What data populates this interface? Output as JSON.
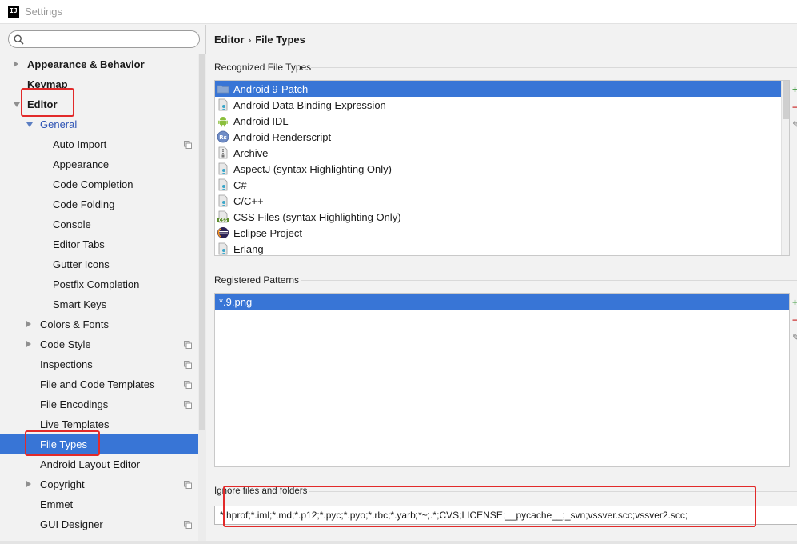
{
  "window": {
    "title": "Settings",
    "app_icon_text": "IJ"
  },
  "search": {
    "placeholder": ""
  },
  "sidebar": {
    "items": [
      {
        "label": "Appearance & Behavior",
        "level": 0,
        "arrow": "right",
        "bold": true
      },
      {
        "label": "Keymap",
        "level": 0,
        "arrow": "none",
        "bold": true
      },
      {
        "label": "Editor",
        "level": 0,
        "arrow": "down",
        "bold": true
      },
      {
        "label": "General",
        "level": 1,
        "arrow": "down",
        "color": "blue"
      },
      {
        "label": "Auto Import",
        "level": 2,
        "copy_icon": true
      },
      {
        "label": "Appearance",
        "level": 2
      },
      {
        "label": "Code Completion",
        "level": 2
      },
      {
        "label": "Code Folding",
        "level": 2
      },
      {
        "label": "Console",
        "level": 2
      },
      {
        "label": "Editor Tabs",
        "level": 2
      },
      {
        "label": "Gutter Icons",
        "level": 2
      },
      {
        "label": "Postfix Completion",
        "level": 2
      },
      {
        "label": "Smart Keys",
        "level": 2
      },
      {
        "label": "Colors & Fonts",
        "level": 1,
        "arrow": "right"
      },
      {
        "label": "Code Style",
        "level": 1,
        "arrow": "right",
        "copy_icon": true
      },
      {
        "label": "Inspections",
        "level": 1,
        "copy_icon": true
      },
      {
        "label": "File and Code Templates",
        "level": 1,
        "copy_icon": true
      },
      {
        "label": "File Encodings",
        "level": 1,
        "copy_icon": true
      },
      {
        "label": "Live Templates",
        "level": 1
      },
      {
        "label": "File Types",
        "level": 1,
        "selected": true
      },
      {
        "label": "Android Layout Editor",
        "level": 1
      },
      {
        "label": "Copyright",
        "level": 1,
        "arrow": "right",
        "copy_icon": true
      },
      {
        "label": "Emmet",
        "level": 1
      },
      {
        "label": "GUI Designer",
        "level": 1,
        "copy_icon": true
      }
    ]
  },
  "breadcrumb": {
    "parent": "Editor",
    "separator": "›",
    "current": "File Types"
  },
  "recognized": {
    "label": "Recognized File Types",
    "items": [
      {
        "label": "Android 9-Patch",
        "icon": "folder-icon",
        "selected": true
      },
      {
        "label": "Android Data Binding Expression",
        "icon": "file-person-icon"
      },
      {
        "label": "Android IDL",
        "icon": "android-icon"
      },
      {
        "label": "Android Renderscript",
        "icon": "rs-icon"
      },
      {
        "label": "Archive",
        "icon": "archive-icon"
      },
      {
        "label": "AspectJ (syntax Highlighting Only)",
        "icon": "file-person-icon"
      },
      {
        "label": "C#",
        "icon": "file-person-icon"
      },
      {
        "label": "C/C++",
        "icon": "file-person-icon"
      },
      {
        "label": "CSS Files (syntax Highlighting Only)",
        "icon": "css-icon"
      },
      {
        "label": "Eclipse Project",
        "icon": "eclipse-icon"
      },
      {
        "label": "Erlang",
        "icon": "file-person-icon"
      }
    ]
  },
  "patterns": {
    "label": "Registered Patterns",
    "items": [
      {
        "label": "*.9.png",
        "selected": true
      }
    ]
  },
  "ignore": {
    "label": "Ignore files and folders",
    "value": "*.hprof;*.iml;*.md;*.p12;*.pyc;*.pyo;*.rbc;*.yarb;*~;.*;CVS;LICENSE;__pycache__;_svn;vssver.scc;vssver2.scc;"
  },
  "tools": {
    "add": "+",
    "remove": "−",
    "edit": "✎"
  },
  "colors": {
    "selection": "#3875d6",
    "annotation": "#e22a2a"
  }
}
